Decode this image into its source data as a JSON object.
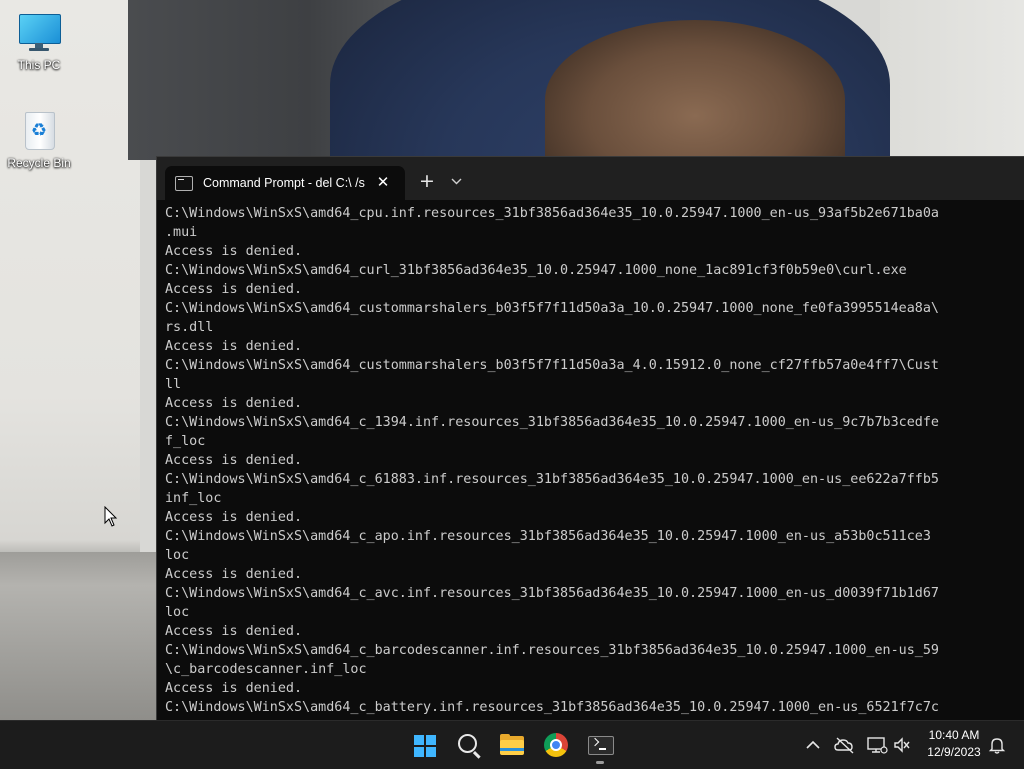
{
  "desktop": {
    "icons": [
      {
        "label": "This PC",
        "icon": "monitor-icon"
      },
      {
        "label": "Recycle Bin",
        "icon": "recycle-bin-icon"
      }
    ]
  },
  "terminal": {
    "tab_title": "Command Prompt - del  C:\\ /s",
    "tab_icon": "command-prompt-icon",
    "new_tab": "+",
    "close": "✕",
    "lines": [
      "C:\\Windows\\WinSxS\\amd64_cpu.inf.resources_31bf3856ad364e35_10.0.25947.1000_en-us_93af5b2e671ba0a",
      ".mui",
      "Access is denied.",
      "C:\\Windows\\WinSxS\\amd64_curl_31bf3856ad364e35_10.0.25947.1000_none_1ac891cf3f0b59e0\\curl.exe",
      "Access is denied.",
      "C:\\Windows\\WinSxS\\amd64_custommarshalers_b03f5f7f11d50a3a_10.0.25947.1000_none_fe0fa3995514ea8a\\",
      "rs.dll",
      "Access is denied.",
      "C:\\Windows\\WinSxS\\amd64_custommarshalers_b03f5f7f11d50a3a_4.0.15912.0_none_cf27ffb57a0e4ff7\\Cust",
      "ll",
      "Access is denied.",
      "C:\\Windows\\WinSxS\\amd64_c_1394.inf.resources_31bf3856ad364e35_10.0.25947.1000_en-us_9c7b7b3cedfe",
      "f_loc",
      "Access is denied.",
      "C:\\Windows\\WinSxS\\amd64_c_61883.inf.resources_31bf3856ad364e35_10.0.25947.1000_en-us_ee622a7ffb5",
      "inf_loc",
      "Access is denied.",
      "C:\\Windows\\WinSxS\\amd64_c_apo.inf.resources_31bf3856ad364e35_10.0.25947.1000_en-us_a53b0c511ce3",
      "loc",
      "Access is denied.",
      "C:\\Windows\\WinSxS\\amd64_c_avc.inf.resources_31bf3856ad364e35_10.0.25947.1000_en-us_d0039f71b1d67",
      "loc",
      "Access is denied.",
      "C:\\Windows\\WinSxS\\amd64_c_barcodescanner.inf.resources_31bf3856ad364e35_10.0.25947.1000_en-us_59",
      "\\c_barcodescanner.inf_loc",
      "Access is denied.",
      "C:\\Windows\\WinSxS\\amd64_c_battery.inf.resources_31bf3856ad364e35_10.0.25947.1000_en-us_6521f7c7c"
    ]
  },
  "taskbar": {
    "pinned": [
      {
        "name": "start-button",
        "icon": "windows-logo-icon"
      },
      {
        "name": "search-button",
        "icon": "search-icon"
      },
      {
        "name": "file-explorer-button",
        "icon": "folder-icon"
      },
      {
        "name": "chrome-button",
        "icon": "chrome-icon"
      },
      {
        "name": "terminal-button",
        "icon": "terminal-icon",
        "active": true
      }
    ],
    "tray_icons": [
      "chevron-up-icon",
      "onedrive-offline-icon",
      "network-icon",
      "volume-muted-icon"
    ],
    "clock": {
      "time": "10:40 AM",
      "date": "12/9/2023"
    },
    "notification_icon": "bell-icon"
  },
  "colors": {
    "terminal_bg": "#0c0c0c",
    "terminal_text": "#cccccc",
    "titlebar_bg": "#202020",
    "taskbar_bg": "#1c1c1c",
    "windows_accent": "#3fb6ff"
  }
}
